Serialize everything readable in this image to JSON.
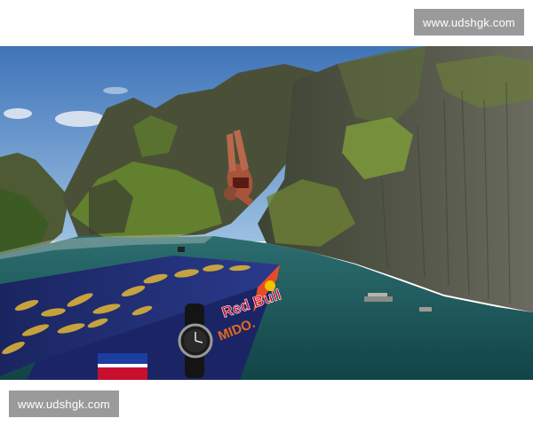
{
  "watermarks": {
    "top_text": "www.udshgk.com",
    "bottom_text": "www.udshgk.com"
  },
  "platform": {
    "brand_label": "Red Bull",
    "sponsor_label": "MIDO."
  },
  "colors": {
    "sky": "#5d90c8",
    "water": "#1f5a5c",
    "cliff": "#4a4a3c",
    "vegetation": "#5d7a2e",
    "platform_blue": "#1c2a7a",
    "platform_gold": "#d8b03a",
    "brand_red": "#c8102e"
  },
  "icons": {
    "watch": "wristwatch-logo-icon",
    "flag": "flag-icon"
  }
}
